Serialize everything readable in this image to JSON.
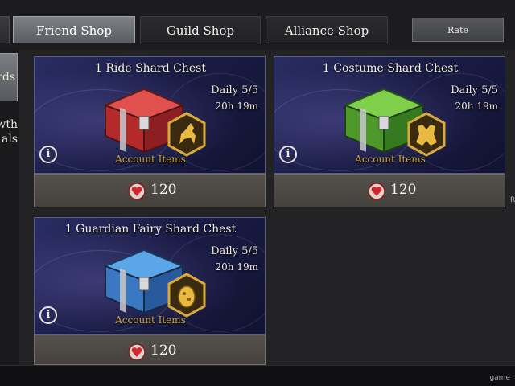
{
  "tabs": [
    {
      "label": "Friend Shop",
      "active": true
    },
    {
      "label": "Guild Shop",
      "active": false
    },
    {
      "label": "Alliance Shop",
      "active": false
    }
  ],
  "rate_button": "Rate",
  "sidebar": {
    "items": [
      {
        "label": "rds",
        "active": true
      },
      {
        "label": "wth als",
        "active": false
      }
    ]
  },
  "edge_mark": "R",
  "colors": {
    "accent": "#c9a640",
    "banner_dark": "#1a1c45",
    "price_bar": "#4c4843"
  },
  "cards": [
    {
      "title": "1 Ride Shard Chest",
      "daily": "Daily 5/5",
      "timer": "20h 19m",
      "category": "Account Items",
      "price": "120",
      "chest_color": "red",
      "badge_icon": "horse-icon"
    },
    {
      "title": "1 Costume Shard Chest",
      "daily": "Daily 5/5",
      "timer": "20h 19m",
      "category": "Account Items",
      "price": "120",
      "chest_color": "green",
      "badge_icon": "armor-icon"
    },
    {
      "title": "1 Guardian Fairy Shard Chest",
      "daily": "Daily 5/5",
      "timer": "20h 19m",
      "category": "Account Items",
      "price": "120",
      "chest_color": "blue",
      "badge_icon": "egg-icon"
    }
  ],
  "info_glyph": "i",
  "watermark": "game"
}
